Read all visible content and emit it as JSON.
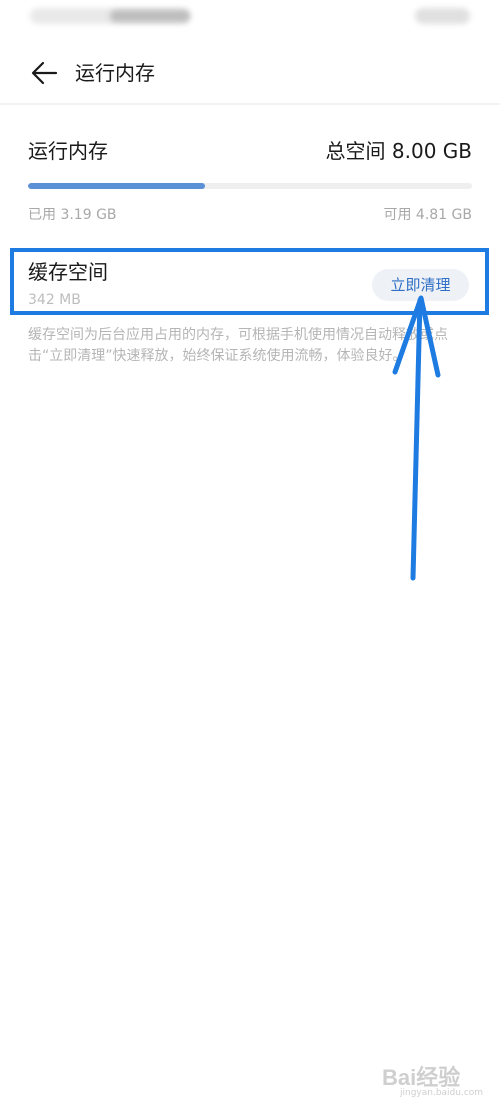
{
  "header": {
    "title": "运行内存"
  },
  "memory": {
    "label": "运行内存",
    "total": "总空间 8.00 GB",
    "used": "已用 3.19 GB",
    "available": "可用 4.81 GB",
    "used_fraction": 0.399
  },
  "cache": {
    "title": "缓存空间",
    "size": "342 MB",
    "clean_label": "立即清理"
  },
  "description": "缓存空间为后台应用占用的内存，可根据手机使用情况自动释放或点击“立即清理”快速释放，始终保证系统使用流畅，体验良好。",
  "watermark": {
    "text": "Bai经验",
    "sub": "jingyan.baidu.com"
  },
  "colors": {
    "accent": "#1d7be2",
    "progress": "#5b8fd6",
    "button_text": "#2f6fc5"
  }
}
